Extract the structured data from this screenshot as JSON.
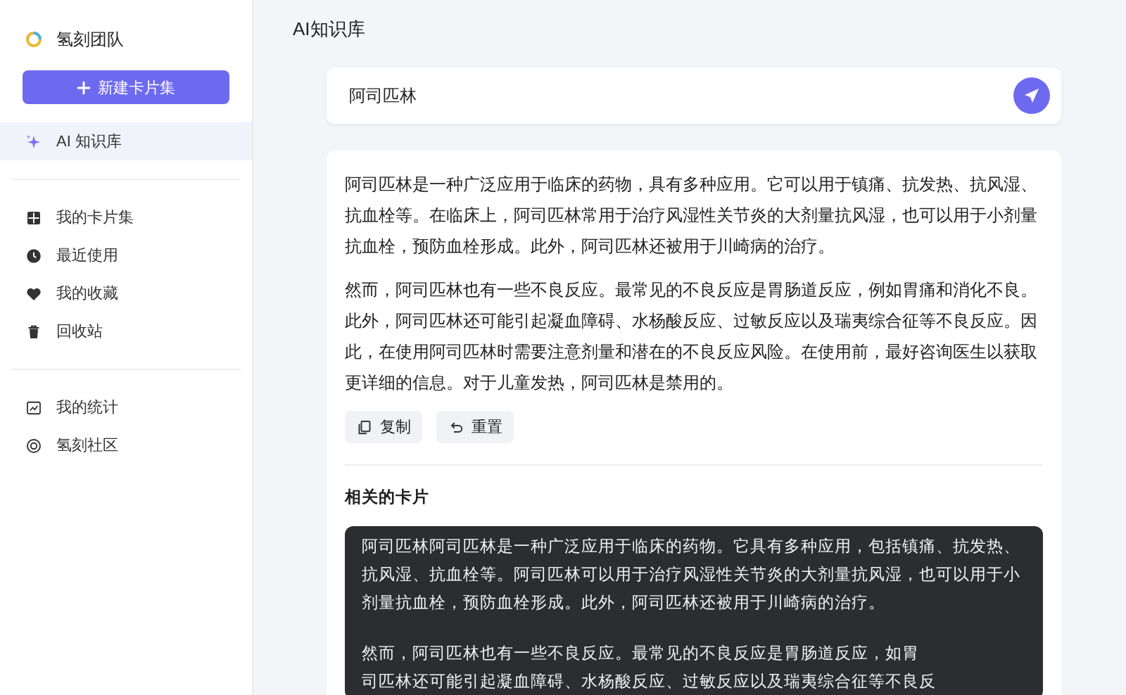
{
  "sidebar": {
    "team_name": "氢刻团队",
    "new_button": "新建卡片集",
    "groups": [
      [
        {
          "label": "AI 知识库",
          "selected": true
        }
      ],
      [
        {
          "label": "我的卡片集",
          "selected": false
        },
        {
          "label": "最近使用",
          "selected": false
        },
        {
          "label": "我的收藏",
          "selected": false
        },
        {
          "label": "回收站",
          "selected": false
        }
      ],
      [
        {
          "label": "我的统计",
          "selected": false
        },
        {
          "label": "氢刻社区",
          "selected": false
        }
      ]
    ]
  },
  "page_title": "AI知识库",
  "query": {
    "value": "阿司匹林"
  },
  "answer": {
    "paragraphs": [
      "阿司匹林是一种广泛应用于临床的药物，具有多种应用。它可以用于镇痛、抗发热、抗风湿、抗血栓等。在临床上，阿司匹林常用于治疗风湿性关节炎的大剂量抗风湿，也可以用于小剂量抗血栓，预防血栓形成。此外，阿司匹林还被用于川崎病的治疗。",
      "然而，阿司匹林也有一些不良反应。最常见的不良反应是胃肠道反应，例如胃痛和消化不良。此外，阿司匹林还可能引起凝血障碍、水杨酸反应、过敏反应以及瑞夷综合征等不良反应。因此，在使用阿司匹林时需要注意剂量和潜在的不良反应风险。在使用前，最好咨询医生以获取更详细的信息。对于儿童发热，阿司匹林是禁用的。"
    ],
    "actions": [
      {
        "label": "复制"
      },
      {
        "label": "重置"
      }
    ]
  },
  "related": {
    "title": "相关的卡片",
    "cards": [
      {
        "paragraphs": [
          "阿司匹林阿司匹林是一种广泛应用于临床的药物。它具有多种应用，包括镇痛、抗发热、抗风湿、抗血栓等。阿司匹林可以用于治疗风湿性关节炎的大剂量抗风湿，也可以用于小剂量抗血栓，预防血栓形成。此外，阿司匹林还被用于川崎病的治疗。"
        ],
        "cut_lines": [
          "然而，阿司匹林也有一些不良反应。最常见的不良反应是胃肠道反应，如胃",
          "司匹林还可能引起凝血障碍、水杨酸反应、过敏反应以及瑞夷综合征等不良反"
        ]
      }
    ]
  }
}
